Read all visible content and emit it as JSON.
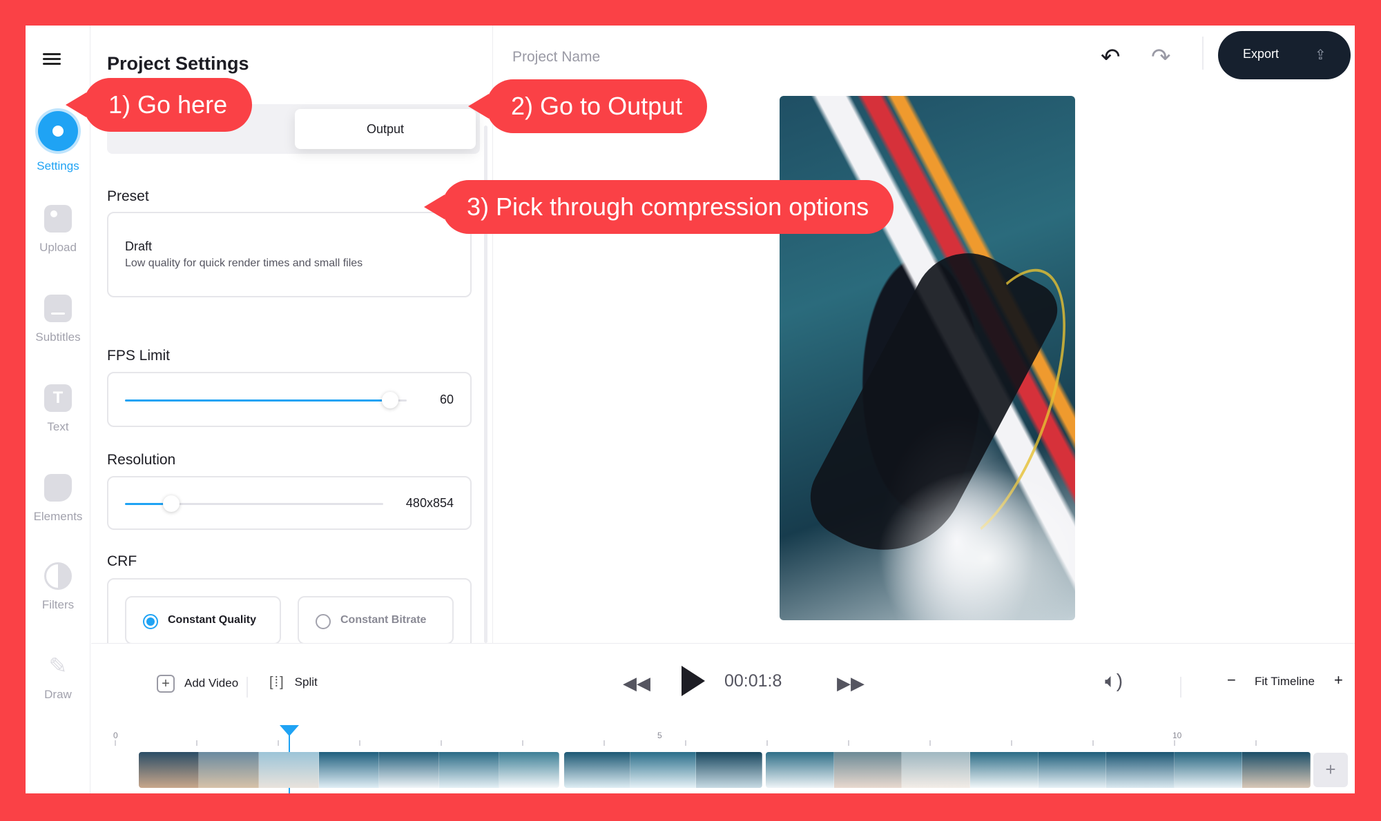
{
  "rail": {
    "items": [
      {
        "label": "Settings",
        "icon": "settings-icon",
        "active": true
      },
      {
        "label": "Upload",
        "icon": "image-icon"
      },
      {
        "label": "Subtitles",
        "icon": "subtitles-icon"
      },
      {
        "label": "Text",
        "icon": "text-icon",
        "glyph": "T"
      },
      {
        "label": "Elements",
        "icon": "sticker-icon"
      },
      {
        "label": "Filters",
        "icon": "filter-icon"
      },
      {
        "label": "Draw",
        "icon": "pencil-icon"
      }
    ]
  },
  "panel": {
    "title": "Project Settings",
    "active_tab": "Output",
    "preset": {
      "label": "Preset",
      "name": "Draft",
      "description": "Low quality for quick render times and small files"
    },
    "fps": {
      "label": "FPS Limit",
      "value": "60",
      "fraction": 0.94
    },
    "resolution": {
      "label": "Resolution",
      "value": "480x854",
      "fraction": 0.18
    },
    "crf": {
      "label": "CRF",
      "options": [
        {
          "label": "Constant Quality",
          "selected": true
        },
        {
          "label": "Constant Bitrate",
          "selected": false
        }
      ]
    }
  },
  "topbar": {
    "project_name": "Project Name",
    "undo_icon": "↶",
    "redo_icon": "↷",
    "export_label": "Export",
    "export_icon": "⇪"
  },
  "bottom": {
    "add_video": "Add Video",
    "split": "Split",
    "timecode": "00:01:8",
    "fit_timeline": "Fit Timeline",
    "zoom_minus": "−",
    "zoom_plus": "+",
    "add_icon": "+",
    "split_icon": "[⁞]",
    "rewind_icon": "◀◀",
    "forward_icon": "▶▶",
    "volume_icon": "🔈︎)",
    "ruler_labels": [
      "0",
      "5",
      "10"
    ],
    "playhead_fraction": 0.146
  },
  "annotations": {
    "step1": "1) Go here",
    "step2": "2) Go to Output",
    "step3": "3) Pick through compression options"
  },
  "colors": {
    "accent": "#1fa3f4",
    "callout": "#fa4146",
    "export_bg": "#16202e"
  }
}
